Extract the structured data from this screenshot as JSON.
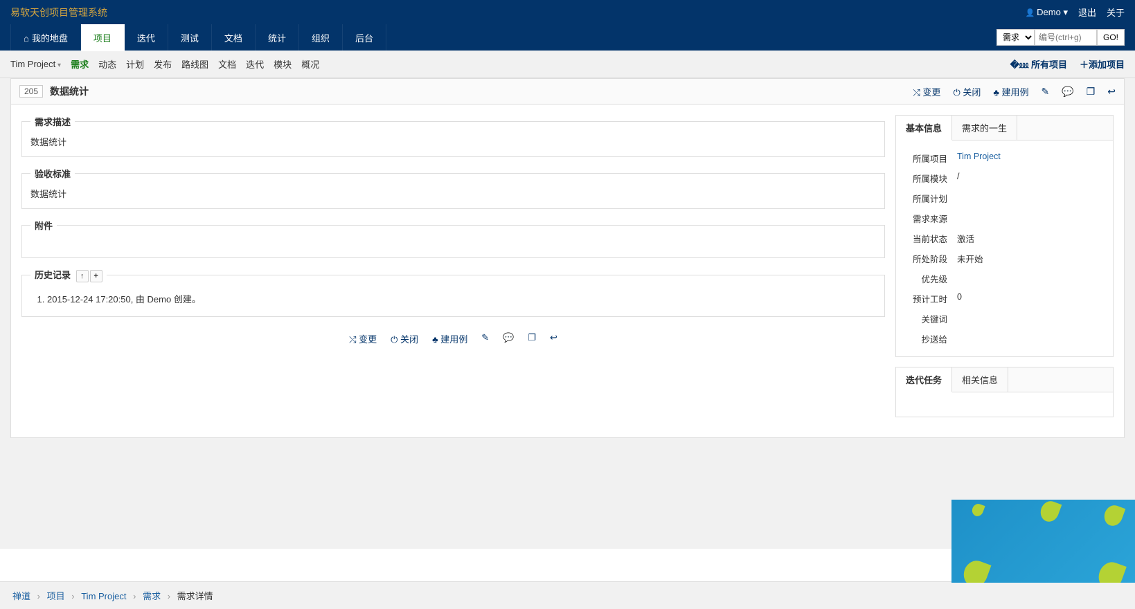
{
  "brand": "易软天创项目管理系统",
  "user": {
    "name": "Demo",
    "logout": "退出",
    "about": "关于"
  },
  "mainNav": [
    "我的地盘",
    "项目",
    "迭代",
    "测试",
    "文档",
    "统计",
    "组织",
    "后台"
  ],
  "mainNavActive": 1,
  "search": {
    "type": "需求",
    "placeholder": "编号(ctrl+g)",
    "go": "GO!"
  },
  "subNav": {
    "project": "Tim Project",
    "items": [
      "需求",
      "动态",
      "计划",
      "发布",
      "路线图",
      "文档",
      "迭代",
      "模块",
      "概况"
    ],
    "activeIndex": 0,
    "rightLinks": {
      "allProjects": "所有项目",
      "addProject": "添加项目"
    }
  },
  "story": {
    "id": "205",
    "title": "数据统计",
    "spec": {
      "label": "需求描述",
      "content": "数据统计"
    },
    "verify": {
      "label": "验收标准",
      "content": "数据统计"
    },
    "files": {
      "label": "附件"
    },
    "history": {
      "label": "历史记录",
      "items": [
        "2015-12-24 17:20:50, 由 Demo 创建。"
      ]
    }
  },
  "actions": {
    "change": "变更",
    "close": "关闭",
    "createCase": "建用例"
  },
  "sideTabs1": {
    "tabs": [
      "基本信息",
      "需求的一生"
    ],
    "rows": [
      {
        "label": "所属项目",
        "value": "Tim Project",
        "link": true
      },
      {
        "label": "所属模块",
        "value": "/"
      },
      {
        "label": "所属计划",
        "value": ""
      },
      {
        "label": "需求来源",
        "value": ""
      },
      {
        "label": "当前状态",
        "value": "激活"
      },
      {
        "label": "所处阶段",
        "value": "未开始"
      },
      {
        "label": "优先级",
        "value": ""
      },
      {
        "label": "预计工时",
        "value": "0"
      },
      {
        "label": "关键词",
        "value": ""
      },
      {
        "label": "抄送给",
        "value": ""
      }
    ]
  },
  "sideTabs2": {
    "tabs": [
      "迭代任务",
      "相关信息"
    ]
  },
  "breadcrumb": {
    "items": [
      "禅道",
      "项目",
      "Tim Project",
      "需求",
      "需求详情"
    ]
  }
}
